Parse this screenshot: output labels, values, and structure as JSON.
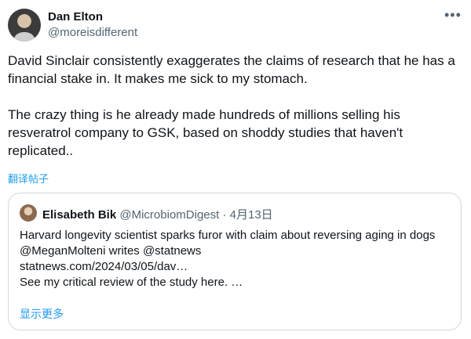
{
  "author": {
    "name": "Dan Elton",
    "handle": "@moreisdifferent"
  },
  "more_icon": "more-horizontal-icon",
  "tweet": {
    "text": "David Sinclair consistently exaggerates the claims of research that he has a financial stake in. It makes me sick to my stomach.\n\nThe crazy thing is he already made hundreds of millions selling his resveratrol company to GSK, based on shoddy studies that haven't replicated..",
    "translate_label": "翻译帖子"
  },
  "quote": {
    "name": "Elisabeth Bik",
    "handle": "@MicrobiomDigest",
    "separator": " · ",
    "date": "4月13日",
    "text": "Harvard longevity scientist sparks furor with claim about reversing aging in dogs\n@MeganMolteni writes @statnews\nstatnews.com/2024/03/05/dav…\nSee my critical review of the study here. …",
    "show_more_label": "显示更多"
  }
}
